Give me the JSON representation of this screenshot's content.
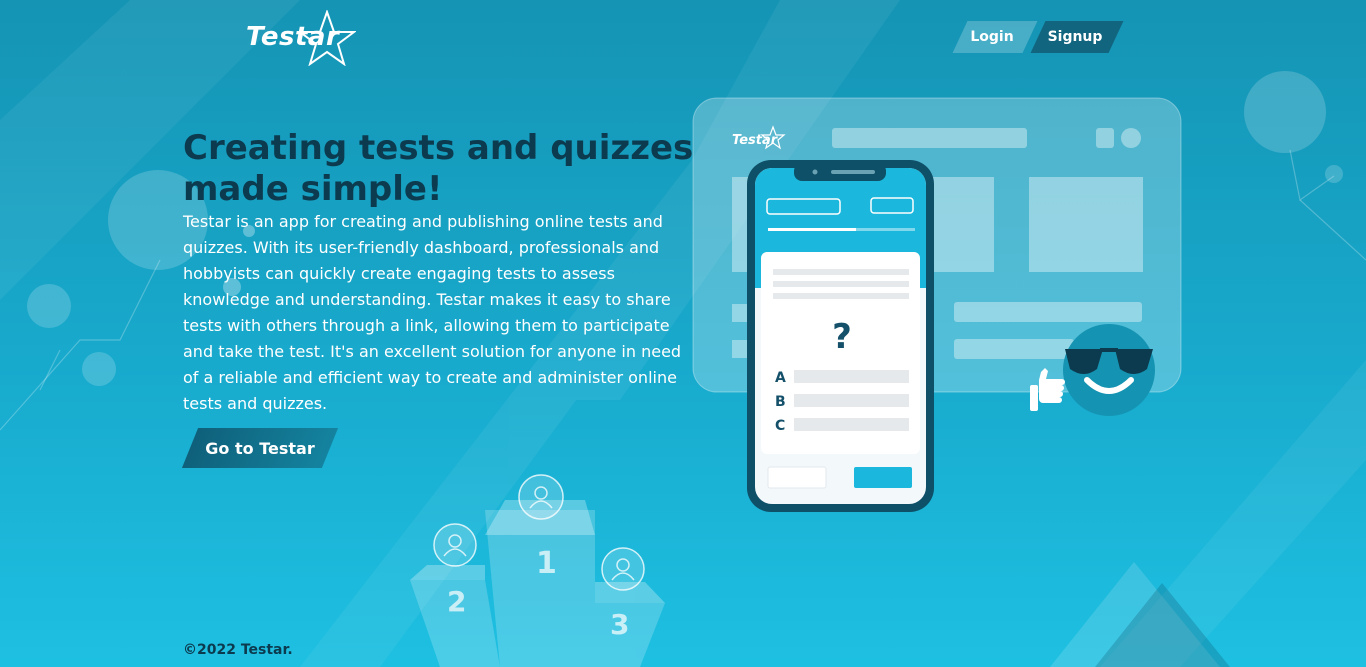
{
  "brand": {
    "name": "Testar",
    "mockup_brand": "Testar"
  },
  "nav": {
    "login_label": "Login",
    "signup_label": "Signup"
  },
  "hero": {
    "title": "Creating tests and quizzes made simple!",
    "description": "Testar is an app for creating and publishing online tests and quizzes. With its user-friendly dashboard, professionals and hobbyists can quickly create engaging tests to assess knowledge and understanding. Testar makes it easy to share tests with others through a link, allowing them to participate and take the test. It's an excellent solution for anyone in need of a reliable and efficient way to create and administer online tests and quizzes.",
    "cta_label": "Go to Testar"
  },
  "illustration": {
    "question_mark": "?",
    "options": [
      "A",
      "B",
      "C"
    ],
    "podium_places": [
      "1",
      "2",
      "3"
    ],
    "icons": [
      "star-icon",
      "smiley-sunglasses-icon",
      "thumbs-up-icon",
      "user-icon"
    ]
  },
  "footer": {
    "copyright": "©2022 Testar."
  },
  "colors": {
    "dark_teal": "#0c3a4e",
    "button_dark": "#11657f",
    "accent_cyan": "#1ec0e2"
  }
}
